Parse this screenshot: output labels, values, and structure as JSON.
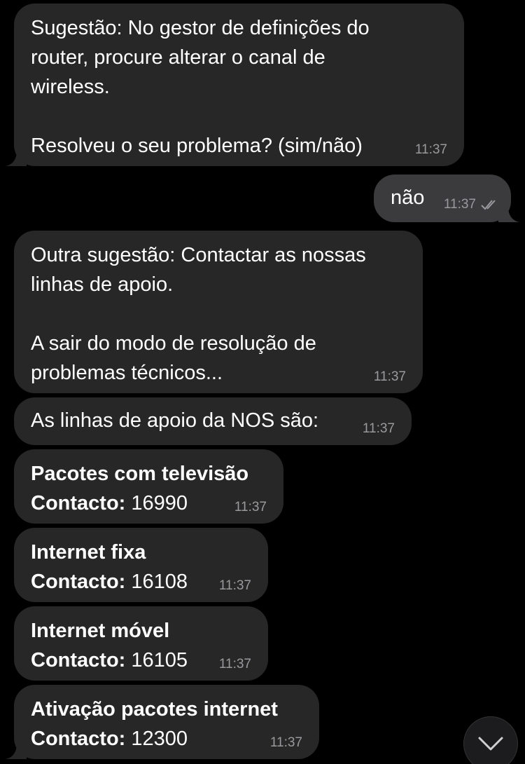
{
  "messages": [
    {
      "direction": "in",
      "lines": [
        "Sugestão: No gestor de definições do",
        "router, procure alterar o canal de",
        "wireless.",
        "",
        "Resolveu o seu problema? (sim/não)"
      ],
      "time": "11:37"
    },
    {
      "direction": "out",
      "lines": [
        "não"
      ],
      "time": "11:37",
      "status": "read"
    },
    {
      "direction": "in",
      "lines": [
        "Outra sugestão: Contactar as nossas",
        "linhas de apoio.",
        "",
        "A sair do modo de resolução de",
        "problemas técnicos..."
      ],
      "time": "11:37"
    },
    {
      "direction": "in",
      "lines": [
        "As linhas de apoio da NOS são:"
      ],
      "time": "11:37"
    },
    {
      "direction": "in",
      "title": "Pacotes com televisão",
      "contact_label": "Contacto:",
      "contact_number": "16990",
      "time": "11:37"
    },
    {
      "direction": "in",
      "title": "Internet fixa",
      "contact_label": "Contacto:",
      "contact_number": "16108",
      "time": "11:37"
    },
    {
      "direction": "in",
      "title": "Internet móvel",
      "contact_label": "Contacto:",
      "contact_number": "16105",
      "time": "11:37"
    },
    {
      "direction": "in",
      "title": "Ativação pacotes internet",
      "contact_label": "Contacto:",
      "contact_number": "12300",
      "time": "11:37"
    }
  ],
  "scroll_button": {
    "icon": "chevron-down-icon"
  },
  "colors": {
    "background": "#000000",
    "incoming_bubble": "#272727",
    "outgoing_bubble": "#3b3b3d",
    "text": "#ffffff",
    "meta": "#9a9a9e"
  }
}
